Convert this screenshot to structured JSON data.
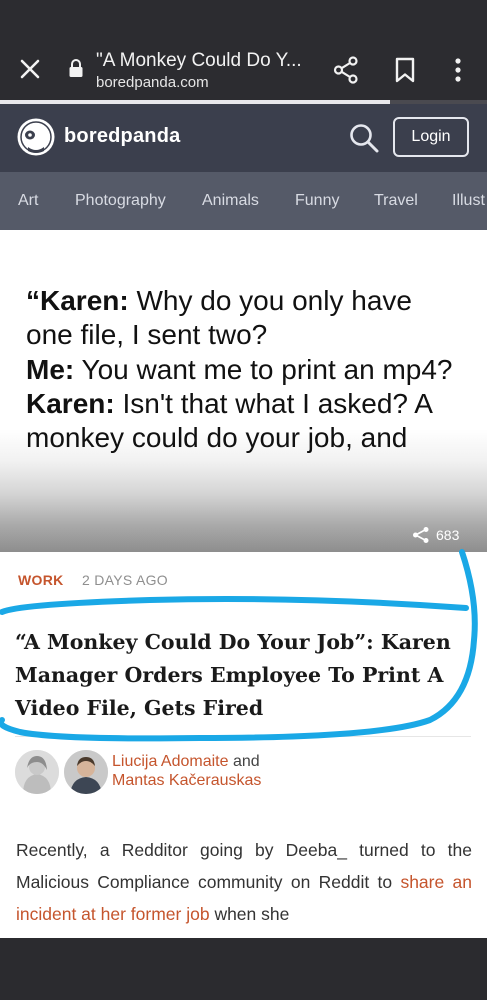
{
  "browser": {
    "tab_title": "\"A Monkey Could Do Y...",
    "domain": "boredpanda.com",
    "load_progress": 0.8
  },
  "site": {
    "logo_text": "boredpanda",
    "login_label": "Login"
  },
  "nav": {
    "categories": [
      "Art",
      "Photography",
      "Animals",
      "Funny",
      "Travel",
      "Illust"
    ]
  },
  "hero": {
    "line1_speaker": "“Karen:",
    "line1_text": " Why do you only have one file, I sent two?",
    "line2_speaker": "Me:",
    "line2_text": " You want me to print an mp4?",
    "line3_speaker": "Karen:",
    "line3_text": " Isn't that what I asked? A monkey could do your job, and",
    "share_count": "683"
  },
  "article": {
    "category": "WORK",
    "date": "2 DAYS AGO",
    "title": "“A Monkey Could Do Your Job”: Karen Manager Orders Employee To Print A Video File, Gets Fired",
    "author1": "Liucija Adomaite",
    "and": " and",
    "author2": "Mantas Kačerauskas",
    "body_prefix": "Recently, a Redditor going by Deeba_ turned to the Malicious Compliance community on Reddit to ",
    "body_link": "share an incident at her former job",
    "body_suffix": " when she"
  },
  "colors": {
    "accent": "#c5552d",
    "header": "#3b3f4d",
    "nav": "#555a68",
    "annotation": "#1aa8e6"
  }
}
